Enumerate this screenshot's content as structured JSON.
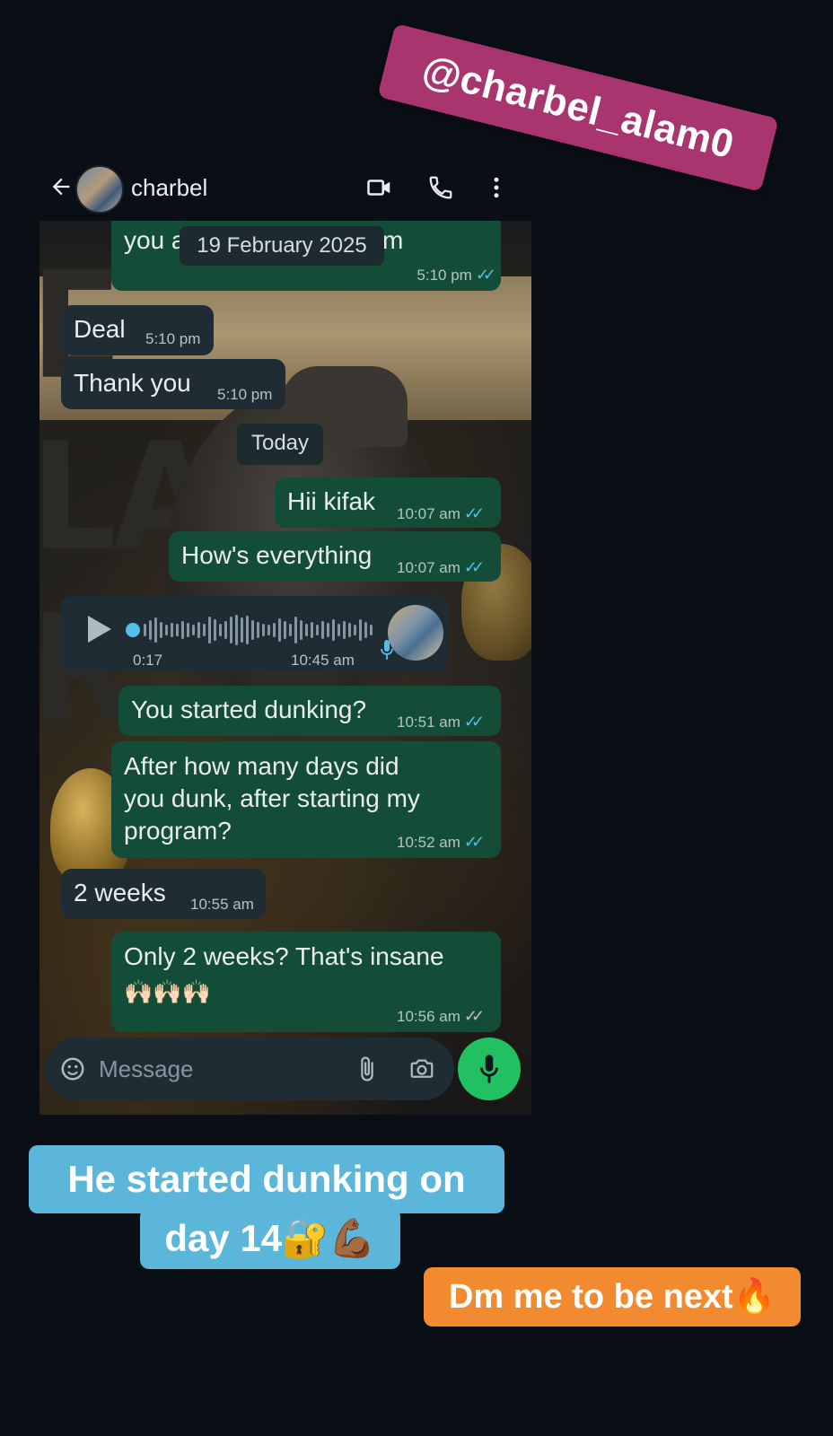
{
  "mention_sticker": {
    "text": "@charbel_alam0"
  },
  "header": {
    "contact_name": "charbel"
  },
  "chat": {
    "partial_top_left": "you a",
    "partial_top_right": "m",
    "partial_top_time": "5:10 pm",
    "date_chip_1": "19 February 2025",
    "date_chip_2": "Today",
    "messages": [
      {
        "dir": "in",
        "text": "Deal",
        "time": "5:10 pm"
      },
      {
        "dir": "in",
        "text": "Thank you",
        "time": "5:10 pm"
      },
      {
        "dir": "out",
        "text": "Hii kifak",
        "time": "10:07 am",
        "read": true
      },
      {
        "dir": "out",
        "text": "How's everything",
        "time": "10:07 am",
        "read": true
      },
      {
        "dir": "out",
        "text": "You started dunking?",
        "time": "10:51 am",
        "read": true
      },
      {
        "dir": "out",
        "text_lines": [
          "After how many days did",
          "you dunk, after starting my",
          "program?"
        ],
        "time": "10:52 am",
        "read": true
      },
      {
        "dir": "in",
        "text": "2 weeks",
        "time": "10:55 am"
      },
      {
        "dir": "out",
        "text": "Only 2 weeks? That's insane",
        "emoji": "🙌🏻🙌🏻🙌🏻",
        "time": "10:56 am",
        "read": false
      }
    ],
    "voice_note": {
      "duration": "0:17",
      "time": "10:45 am"
    }
  },
  "input": {
    "placeholder": "Message"
  },
  "captions": {
    "line1": "He started dunking on",
    "line2": "day 14🔐💪🏾",
    "cta": "Dm me to be next🔥"
  },
  "colors": {
    "bg": "#0a0e15",
    "incoming_bubble": "#202c33",
    "outgoing_bubble": "#144d37",
    "read_tick": "#53bdeb",
    "mic_button": "#21c063",
    "mention": "#a8356e",
    "caption_blue": "#5bb6da",
    "caption_orange": "#f28b30"
  }
}
